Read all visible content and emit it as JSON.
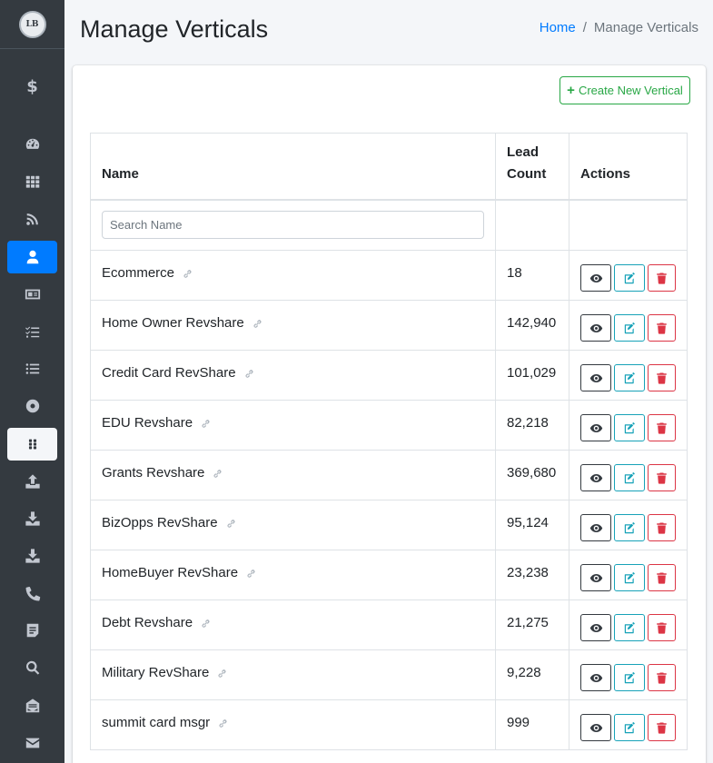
{
  "user": {
    "initials": "LB"
  },
  "header": {
    "title": "Manage Verticals",
    "breadcrumb": {
      "home": "Home",
      "separator": "/",
      "current": "Manage Verticals"
    }
  },
  "toolbar": {
    "create_label": "Create New Vertical"
  },
  "table": {
    "columns": {
      "name": "Name",
      "lead_count": "Lead Count",
      "actions": "Actions"
    },
    "search_placeholder": "Search Name",
    "rows": [
      {
        "name": "Ecommerce",
        "count": "18"
      },
      {
        "name": "Home Owner Revshare",
        "count": "142,940"
      },
      {
        "name": "Credit Card RevShare",
        "count": "101,029"
      },
      {
        "name": "EDU Revshare",
        "count": "82,218"
      },
      {
        "name": "Grants Revshare",
        "count": "369,680"
      },
      {
        "name": "BizOpps RevShare",
        "count": "95,124"
      },
      {
        "name": "HomeBuyer RevShare",
        "count": "23,238"
      },
      {
        "name": "Debt Revshare",
        "count": "21,275"
      },
      {
        "name": "Military RevShare",
        "count": "9,228"
      },
      {
        "name": "summit card msgr",
        "count": "999"
      }
    ]
  },
  "sidebar": {
    "icons": [
      "dollar-icon",
      "tachometer-icon",
      "th-grid-icon",
      "rss-icon",
      "user-icon",
      "id-card-icon",
      "tasks-icon",
      "list-icon",
      "dot-circle-icon",
      "grip-icon",
      "upload-icon",
      "download-icon",
      "download-alt-icon",
      "phone-icon",
      "file-alt-icon",
      "search-icon",
      "envelope-open-icon",
      "envelope-icon"
    ]
  },
  "colors": {
    "primary": "#007bff",
    "success": "#28a745",
    "info": "#17a2b8",
    "danger": "#dc3545",
    "sidebar": "#343a40"
  }
}
